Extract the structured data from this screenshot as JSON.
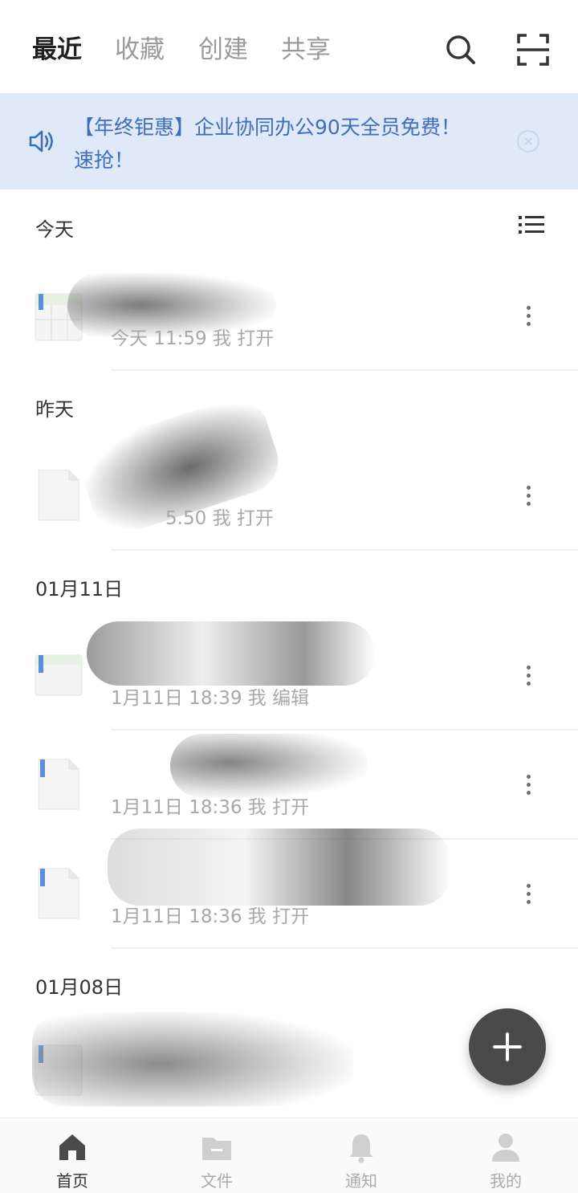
{
  "header": {
    "tabs": [
      {
        "label": "最近",
        "active": true
      },
      {
        "label": "收藏",
        "active": false
      },
      {
        "label": "创建",
        "active": false
      },
      {
        "label": "共享",
        "active": false
      }
    ],
    "icons": [
      "search-icon",
      "scan-icon"
    ]
  },
  "banner": {
    "text": "【年终钜惠】企业协同办公90天全员免费！速抢！",
    "icon": "speaker-icon",
    "close_icon": "close-circle-icon",
    "background": "#dfe9f7",
    "text_color": "#3f6fb8"
  },
  "sections": [
    {
      "label": "今天",
      "files": [
        {
          "name": "",
          "meta": "今天 11:59 我 打开",
          "icon": "spreadsheet-icon"
        }
      ]
    },
    {
      "label": "昨天",
      "files": [
        {
          "name": "",
          "meta": "5.50 我 打开",
          "icon": "document-icon"
        }
      ]
    },
    {
      "label": "01月11日",
      "files": [
        {
          "name": "",
          "meta": "1月11日 18:39 我 编辑",
          "icon": "spreadsheet-icon"
        },
        {
          "name": "",
          "meta": "1月11日 18:36 我 打开",
          "icon": "document-icon"
        },
        {
          "name": "",
          "meta": "1月11日 18:36 我 打开",
          "icon": "document-icon"
        }
      ]
    },
    {
      "label": "01月08日",
      "files": [
        {
          "name": "",
          "meta": "",
          "icon": "spreadsheet-icon"
        }
      ]
    }
  ],
  "fab": {
    "icon": "plus-icon"
  },
  "bottom_nav": [
    {
      "label": "首页",
      "icon": "home-icon",
      "active": true
    },
    {
      "label": "文件",
      "icon": "folder-icon",
      "active": false
    },
    {
      "label": "通知",
      "icon": "bell-icon",
      "active": false
    },
    {
      "label": "我的",
      "icon": "person-icon",
      "active": false
    }
  ]
}
